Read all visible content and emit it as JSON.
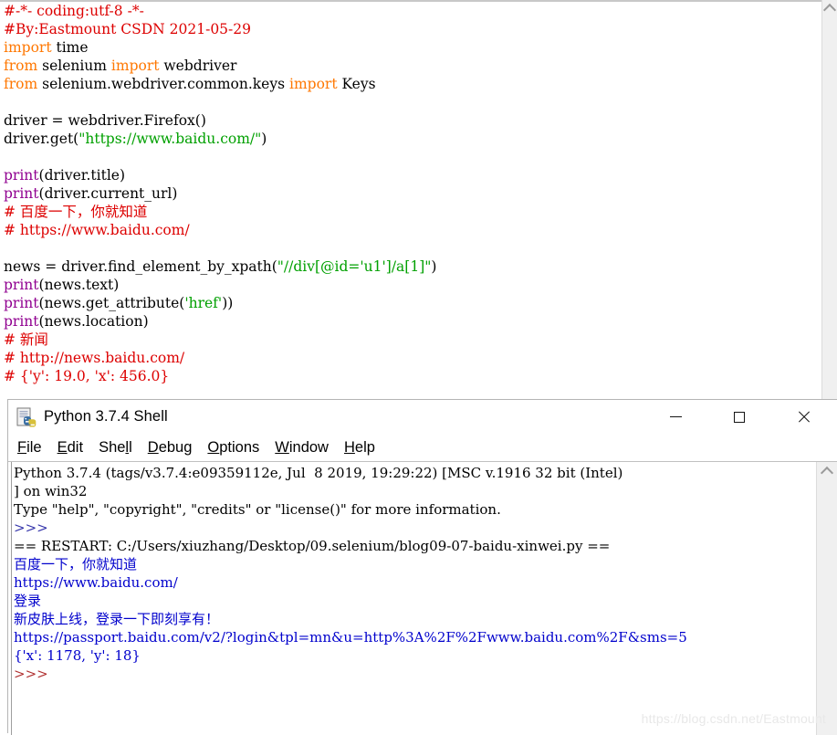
{
  "editor": {
    "name": "python-idle-editor",
    "scrollbar": {
      "up_arrow": "chevron-up-icon"
    },
    "lines": [
      [
        {
          "t": "#-*- coding:utf-8 -*-",
          "c": "red"
        }
      ],
      [
        {
          "t": "#By:Eastmount CSDN 2021-05-29",
          "c": "red"
        }
      ],
      [
        {
          "t": "import",
          "c": "orange"
        },
        {
          "t": " time",
          "c": "black"
        }
      ],
      [
        {
          "t": "from",
          "c": "orange"
        },
        {
          "t": " selenium ",
          "c": "black"
        },
        {
          "t": "import",
          "c": "orange"
        },
        {
          "t": " webdriver",
          "c": "black"
        }
      ],
      [
        {
          "t": "from",
          "c": "orange"
        },
        {
          "t": " selenium.webdriver.common.keys ",
          "c": "black"
        },
        {
          "t": "import",
          "c": "orange"
        },
        {
          "t": " Keys",
          "c": "black"
        }
      ],
      [
        {
          "t": "",
          "c": "black"
        }
      ],
      [
        {
          "t": "driver = webdriver.Firefox()",
          "c": "black"
        }
      ],
      [
        {
          "t": "driver.get(",
          "c": "black"
        },
        {
          "t": "\"https://www.baidu.com/\"",
          "c": "green"
        },
        {
          "t": ")",
          "c": "black"
        }
      ],
      [
        {
          "t": "",
          "c": "black"
        }
      ],
      [
        {
          "t": "print",
          "c": "purple"
        },
        {
          "t": "(driver.title)",
          "c": "black"
        }
      ],
      [
        {
          "t": "print",
          "c": "purple"
        },
        {
          "t": "(driver.current_url)",
          "c": "black"
        }
      ],
      [
        {
          "t": "# 百度一下，你就知道",
          "c": "red"
        }
      ],
      [
        {
          "t": "# https://www.baidu.com/",
          "c": "red"
        }
      ],
      [
        {
          "t": "",
          "c": "black"
        }
      ],
      [
        {
          "t": "news = driver.find_element_by_xpath(",
          "c": "black"
        },
        {
          "t": "\"//div[@id='u1']/a[1]\"",
          "c": "green"
        },
        {
          "t": ")",
          "c": "black"
        }
      ],
      [
        {
          "t": "print",
          "c": "purple"
        },
        {
          "t": "(news.text)",
          "c": "black"
        }
      ],
      [
        {
          "t": "print",
          "c": "purple"
        },
        {
          "t": "(news.get_attribute(",
          "c": "black"
        },
        {
          "t": "'href'",
          "c": "green"
        },
        {
          "t": "))",
          "c": "black"
        }
      ],
      [
        {
          "t": "print",
          "c": "purple"
        },
        {
          "t": "(news.location)",
          "c": "black"
        }
      ],
      [
        {
          "t": "# 新闻",
          "c": "red"
        }
      ],
      [
        {
          "t": "# http://news.baidu.com/",
          "c": "red"
        }
      ],
      [
        {
          "t": "# {'y': 19.0, 'x': 456.0}",
          "c": "red"
        }
      ]
    ]
  },
  "shell": {
    "title": "Python 3.7.4 Shell",
    "icon": "python-file-icon",
    "window_controls": {
      "minimize": "minimize-icon",
      "maximize": "maximize-icon",
      "close": "close-icon"
    },
    "menu": [
      {
        "mnemonic": "F",
        "rest": "ile"
      },
      {
        "mnemonic": "E",
        "rest": "dit"
      },
      {
        "pre": "She",
        "mnemonic": "l",
        "rest": "l"
      },
      {
        "mnemonic": "D",
        "rest": "ebug"
      },
      {
        "mnemonic": "O",
        "rest": "ptions"
      },
      {
        "mnemonic": "W",
        "rest": "indow"
      },
      {
        "mnemonic": "H",
        "rest": "elp"
      }
    ],
    "scrollbar": {
      "up_arrow": "chevron-up-icon"
    },
    "lines": [
      [
        {
          "t": "Python 3.7.4 (tags/v3.7.4:e09359112e, Jul  8 2019, 19:29:22) [MSC v.1916 32 bit (Intel)",
          "c": "black"
        }
      ],
      [
        {
          "t": "] on win32",
          "c": "black"
        }
      ],
      [
        {
          "t": "Type \"help\", \"copyright\", \"credits\" or \"license()\" for more information.",
          "c": "black"
        }
      ],
      [
        {
          "t": ">>>",
          "c": "prompt"
        }
      ],
      [
        {
          "t": "== RESTART: C:/Users/xiuzhang/Desktop/09.selenium/blog09-07-baidu-xinwei.py ==",
          "c": "black"
        }
      ],
      [
        {
          "t": "百度一下，你就知道",
          "c": "blue"
        }
      ],
      [
        {
          "t": "https://www.baidu.com/",
          "c": "blue"
        }
      ],
      [
        {
          "t": "登录",
          "c": "blue"
        }
      ],
      [
        {
          "t": "新皮肤上线，登录一下即刻享有！",
          "c": "blue"
        }
      ],
      [
        {
          "t": "https://passport.baidu.com/v2/?login&tpl=mn&u=http%3A%2F%2Fwww.baidu.com%2F&sms=5",
          "c": "blue"
        }
      ],
      [
        {
          "t": "{'x': 1178, 'y': 18}",
          "c": "blue"
        }
      ],
      [
        {
          "t": ">>>",
          "c": "maroon"
        }
      ]
    ]
  },
  "watermark": {
    "text": "https://blog.csdn.net/Eastmount"
  },
  "colors": {
    "comment": "#dd0000",
    "keyword": "#ff7700",
    "string": "#00a000",
    "builtin": "#900090",
    "output": "#0000cc",
    "prompt": "#3333aa"
  }
}
